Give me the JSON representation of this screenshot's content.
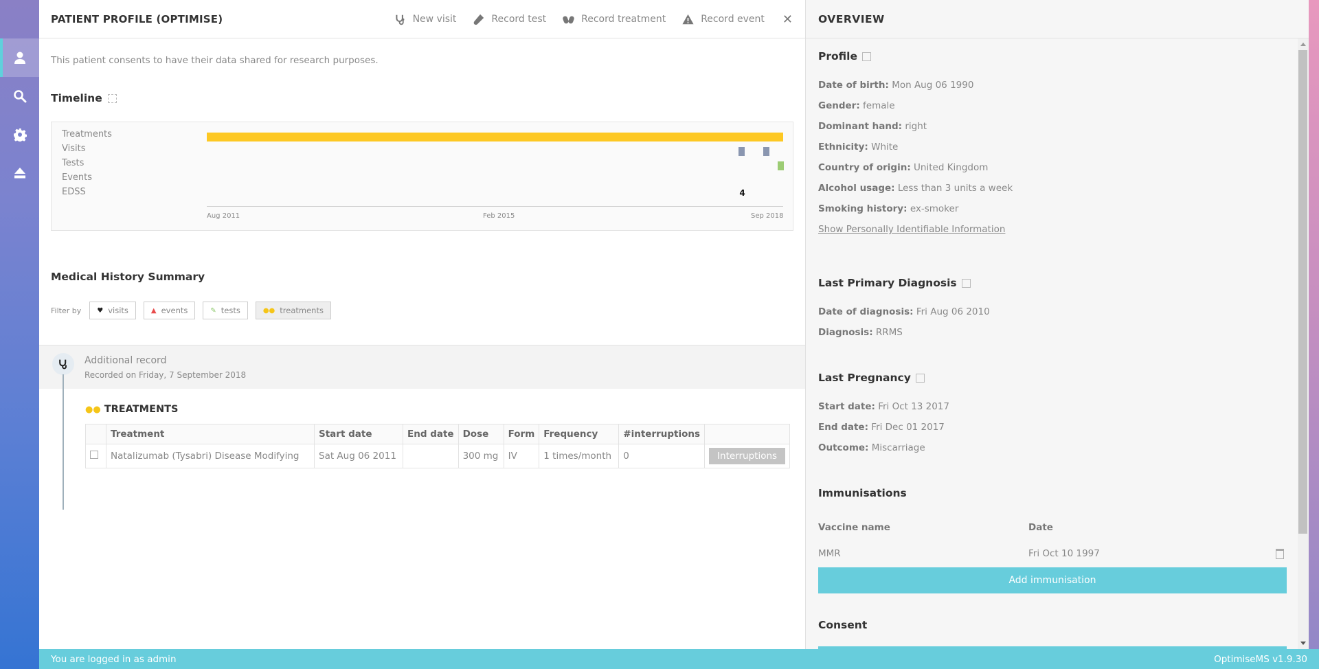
{
  "sidebar": {
    "items": [
      {
        "name": "profile",
        "icon": "user-icon",
        "active": true
      },
      {
        "name": "search",
        "icon": "search-icon",
        "active": false
      },
      {
        "name": "settings",
        "icon": "gear-icon",
        "active": false
      },
      {
        "name": "logout",
        "icon": "eject-icon",
        "active": false
      }
    ]
  },
  "header": {
    "title": "PATIENT PROFILE (OPTIMISE)",
    "actions": [
      {
        "label": "New visit",
        "icon": "stethoscope-icon"
      },
      {
        "label": "Record test",
        "icon": "test-tube-icon"
      },
      {
        "label": "Record treatment",
        "icon": "pills-icon"
      },
      {
        "label": "Record event",
        "icon": "warning-icon"
      }
    ],
    "close_icon": "close-icon"
  },
  "main": {
    "consent_text": "This patient consents to have their data shared for research purposes.",
    "timeline": {
      "title": "Timeline",
      "rows": [
        "Treatments",
        "Visits",
        "Tests",
        "Events",
        "EDSS"
      ],
      "axis_ticks": [
        "Aug 2011",
        "Feb 2015",
        "Sep 2018"
      ],
      "range": {
        "start": "Aug 2011",
        "end": "Sep 2018"
      },
      "treatments": [
        {
          "start": 0.0,
          "end": 1.0
        }
      ],
      "visits": [
        0.923,
        0.966
      ],
      "tests": [
        0.99
      ],
      "edss": [
        {
          "position": 0.923,
          "value": "4"
        }
      ],
      "colors": {
        "treatments": "#fdc823",
        "visits": "#8a96b0",
        "tests": "#9ccc74"
      }
    },
    "history": {
      "title": "Medical History Summary",
      "filter_label": "Filter by",
      "filters": [
        {
          "label": "visits",
          "icon": "heart-icon",
          "active": false
        },
        {
          "label": "events",
          "icon": "warning-icon",
          "active": false
        },
        {
          "label": "tests",
          "icon": "test-tube-icon",
          "active": false
        },
        {
          "label": "treatments",
          "icon": "pills-icon",
          "active": true
        }
      ],
      "record": {
        "title": "Additional record",
        "subtitle": "Recorded on Friday, 7 September 2018",
        "section_title": "TREATMENTS",
        "table": {
          "headers": [
            "",
            "Treatment",
            "Start date",
            "End date",
            "Dose",
            "Form",
            "Frequency",
            "#interruptions",
            ""
          ],
          "rows": [
            {
              "treatment": "Natalizumab (Tysabri) Disease Modifying",
              "start_date": "Sat Aug 06 2011",
              "end_date": "",
              "dose": "300 mg",
              "form": "IV",
              "frequency": "1 times/month",
              "interruptions": "0",
              "action_label": "Interruptions"
            }
          ]
        }
      }
    }
  },
  "overview": {
    "title": "OVERVIEW",
    "profile": {
      "title": "Profile",
      "fields": [
        {
          "label": "Date of birth:",
          "value": "Mon Aug 06 1990"
        },
        {
          "label": "Gender:",
          "value": "female"
        },
        {
          "label": "Dominant hand:",
          "value": "right"
        },
        {
          "label": "Ethnicity:",
          "value": "White"
        },
        {
          "label": "Country of origin:",
          "value": "United Kingdom"
        },
        {
          "label": "Alcohol usage:",
          "value": "Less than 3 units a week"
        },
        {
          "label": "Smoking history:",
          "value": "ex-smoker"
        }
      ],
      "pii_link": "Show Personally Identifiable Information"
    },
    "diagnosis": {
      "title": "Last Primary Diagnosis",
      "fields": [
        {
          "label": "Date of diagnosis:",
          "value": "Fri Aug 06 2010"
        },
        {
          "label": "Diagnosis:",
          "value": "RRMS"
        }
      ]
    },
    "pregnancy": {
      "title": "Last Pregnancy",
      "fields": [
        {
          "label": "Start date:",
          "value": "Fri Oct 13 2017"
        },
        {
          "label": "End date:",
          "value": "Fri Dec 01 2017"
        },
        {
          "label": "Outcome:",
          "value": "Miscarriage"
        }
      ]
    },
    "immunisations": {
      "title": "Immunisations",
      "headers": [
        "Vaccine name",
        "Date"
      ],
      "rows": [
        {
          "vaccine": "MMR",
          "date": "Fri Oct 10 1997"
        }
      ],
      "add_label": "Add immunisation"
    },
    "consent": {
      "title": "Consent"
    }
  },
  "footer": {
    "login_text": "You are logged in as admin",
    "version": "OptimiseMS v1.9.30"
  },
  "colors": {
    "accent": "#67cddc",
    "treatment": "#fdc823"
  }
}
